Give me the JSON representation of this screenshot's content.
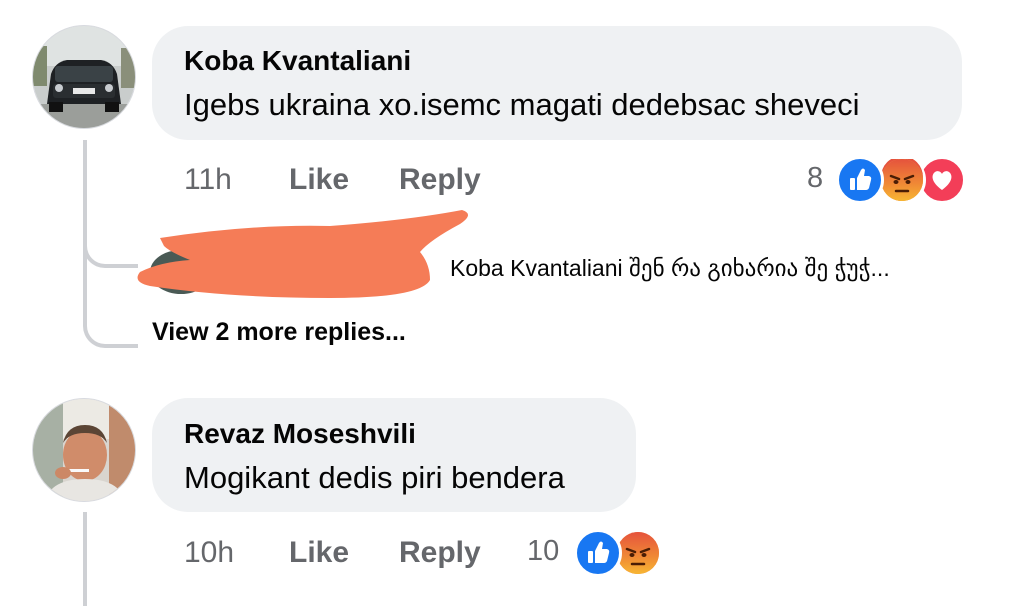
{
  "comments": [
    {
      "author": "Koba Kvantaliani",
      "text": "Igebs ukraina xo.isemc magati dedebsac sheveci",
      "time": "11h",
      "like": "Like",
      "reply": "Reply",
      "reaction_count": "8",
      "reactions": [
        "like-icon",
        "angry-icon",
        "love-icon"
      ]
    },
    {
      "author": "Revaz Moseshvili",
      "text": "Mogikant dedis piri bendera",
      "time": "10h",
      "like": "Like",
      "reply": "Reply",
      "reaction_count": "10",
      "reactions": [
        "like-icon",
        "angry-icon"
      ]
    }
  ],
  "reply_preview": {
    "text": "Koba Kvantaliani შენ რა გიხარია შე ჭუჭ..."
  },
  "view_more": "View 2 more replies...",
  "colors": {
    "bubble": "#eff1f3",
    "meta": "#65676b",
    "like": "#1877f2",
    "angry": "#f0772b",
    "love": "#f33e58",
    "redaction": "#f57c57"
  }
}
